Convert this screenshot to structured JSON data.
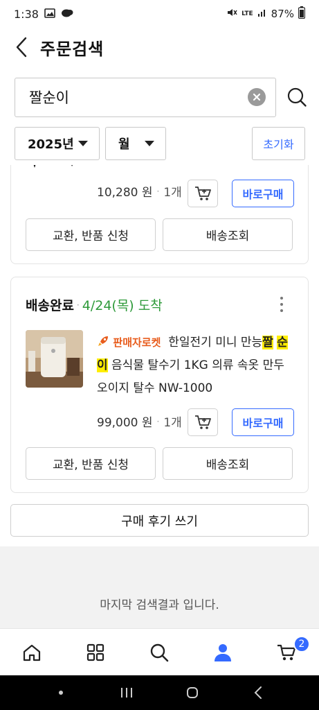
{
  "status_bar": {
    "time": "1:38",
    "battery": "87%",
    "network": "LTE"
  },
  "header": {
    "title": "주문검색"
  },
  "search": {
    "value": "짤순이"
  },
  "filters": {
    "year": "2025년",
    "month": "월",
    "reset_label": "초기화"
  },
  "order_prev": {
    "price": "10,280 원",
    "qty": "1개",
    "buy_label": "바로구매",
    "exchange_label": "교환, 반품 신청",
    "tracking_label": "배송조회"
  },
  "order_main": {
    "status": "배송완료",
    "arrival": "4/24(목) 도착",
    "badge": "판매자로켓",
    "product_pre": "한일전기 미니 만능",
    "product_hl1": "짤",
    "product_hl2": "순이",
    "product_post": "음식물 탈수기 1KG 의류 속옷 만두 오이지 탈수 NW-1000",
    "price": "99,000 원",
    "qty": "1개",
    "buy_label": "바로구매",
    "exchange_label": "교환, 반품 신청",
    "tracking_label": "배송조회"
  },
  "review": {
    "label": "구매 후기 쓰기"
  },
  "end_message": "마지막 검색결과 입니다.",
  "bottom_nav": {
    "cart_count": "2"
  },
  "colors": {
    "accent": "#346aff",
    "arrival_green": "#2e9a3a",
    "rocket_orange": "#e85c1c",
    "highlight": "#ffee00"
  }
}
